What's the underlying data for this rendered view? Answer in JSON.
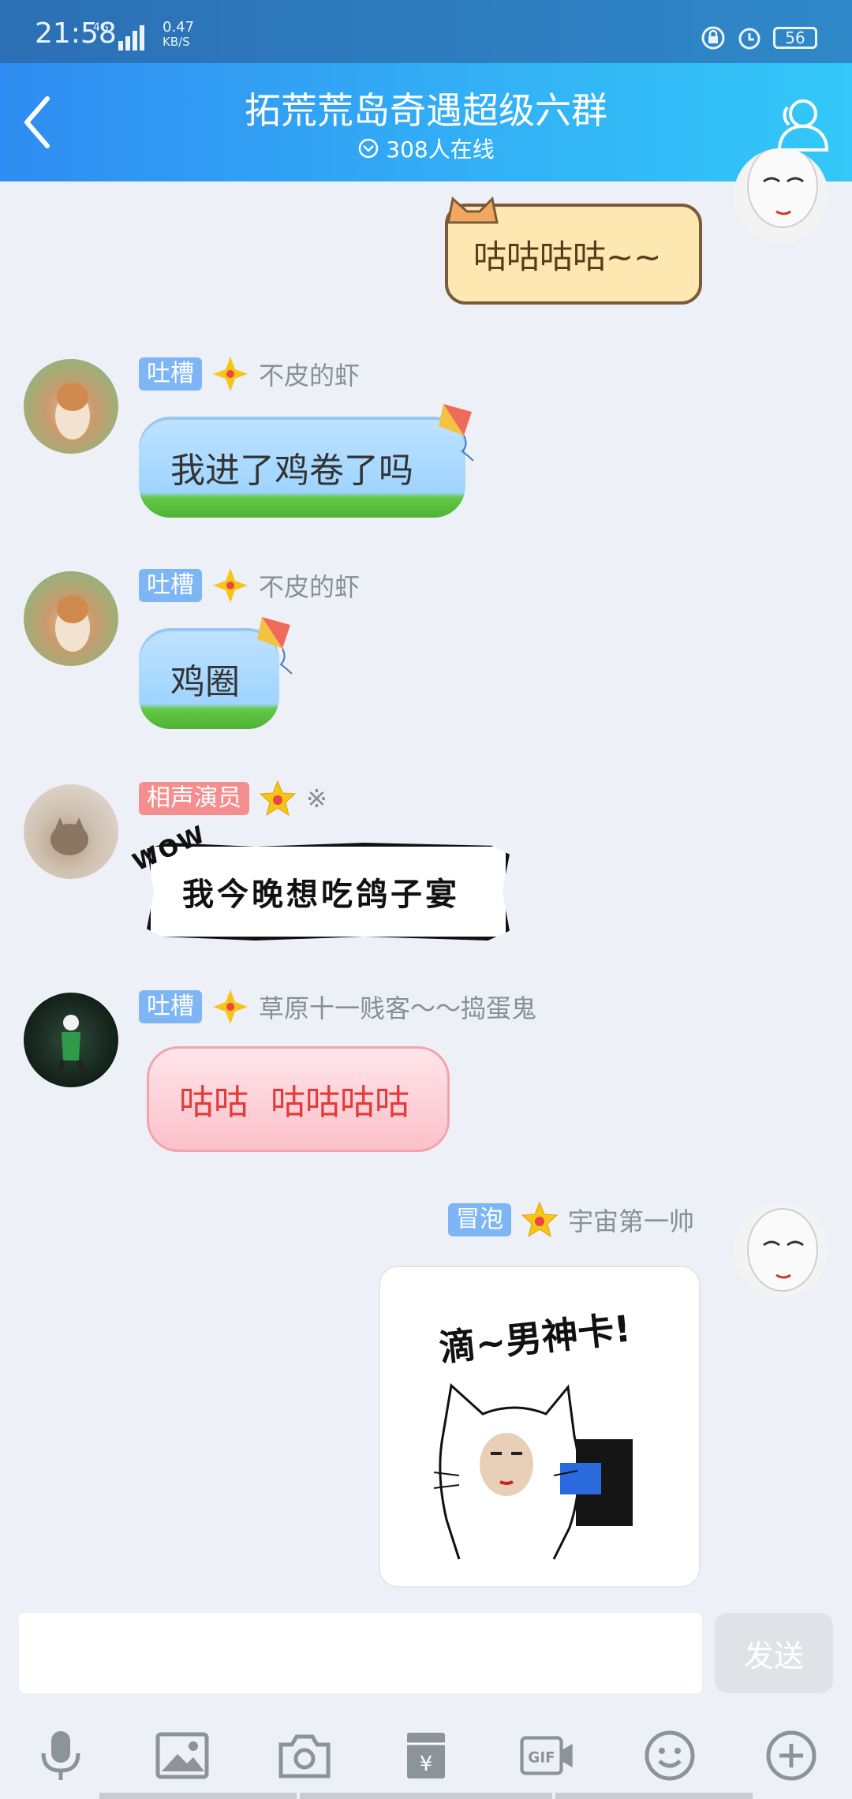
{
  "status": {
    "time": "21:58",
    "network": "4G",
    "speed_value": "0.47",
    "speed_unit": "KB/S",
    "battery": "56"
  },
  "nav": {
    "title": "拓荒荒岛奇遇超级六群",
    "online": "308人在线"
  },
  "messages": [
    {
      "text": "咕咕咕咕~~"
    },
    {
      "tag": "吐槽",
      "name": "不皮的虾",
      "text": "我进了鸡卷了吗"
    },
    {
      "tag": "吐槽",
      "name": "不皮的虾",
      "text": "鸡圈"
    },
    {
      "tag": "相声演员",
      "name": "※",
      "badge": "WOW",
      "text": "我今晚想吃鸽子宴"
    },
    {
      "tag": "吐槽",
      "name": "草原十一贱客～～捣蛋鬼",
      "text": "咕咕  咕咕咕咕"
    },
    {
      "tag": "冒泡",
      "name": "宇宙第一帅",
      "sticker_text": "滴~男神卡!"
    }
  ],
  "input": {
    "value": "",
    "placeholder": ""
  },
  "send_label": "发送",
  "toolbar": [
    "mic-icon",
    "image-icon",
    "camera-icon",
    "red-packet-icon",
    "gif-icon",
    "emoji-icon",
    "plus-icon"
  ],
  "colors": {
    "header": "#2f8cf2",
    "tag_blue": "#7eb5f5",
    "tag_red": "#f58f8f",
    "nick": "#8a8f96"
  }
}
